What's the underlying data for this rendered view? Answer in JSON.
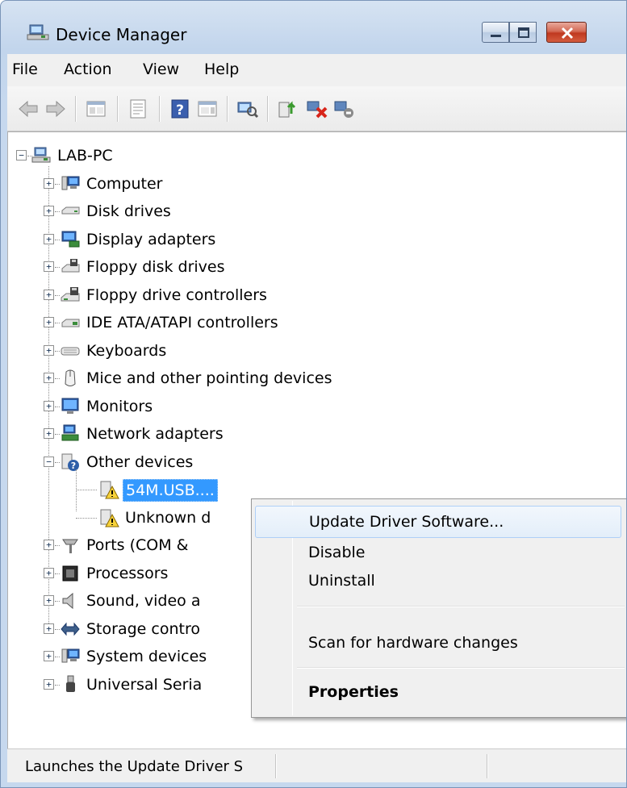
{
  "window": {
    "title": "Device Manager",
    "controls": {
      "minimize": "minimize-icon",
      "maximize": "maximize-icon",
      "close": "close-icon"
    }
  },
  "menubar": {
    "items": [
      "File",
      "Action",
      "View",
      "Help"
    ]
  },
  "toolbar": {
    "icons": [
      "back-arrow-icon",
      "forward-arrow-icon",
      "console-tree-icon",
      "properties-sheet-icon",
      "help-icon",
      "action-pane-icon",
      "scan-hardware-icon",
      "update-driver-icon",
      "uninstall-icon",
      "disable-icon"
    ]
  },
  "tree": {
    "root": "LAB-PC",
    "categories": [
      {
        "label": "Computer",
        "icon": "computer-icon"
      },
      {
        "label": "Disk drives",
        "icon": "disk-drive-icon"
      },
      {
        "label": "Display adapters",
        "icon": "display-adapter-icon"
      },
      {
        "label": "Floppy disk drives",
        "icon": "floppy-disk-icon"
      },
      {
        "label": "Floppy drive controllers",
        "icon": "floppy-controller-icon"
      },
      {
        "label": "IDE ATA/ATAPI controllers",
        "icon": "ide-controller-icon"
      },
      {
        "label": "Keyboards",
        "icon": "keyboard-icon"
      },
      {
        "label": "Mice and other pointing devices",
        "icon": "mouse-icon"
      },
      {
        "label": "Monitors",
        "icon": "monitor-icon"
      },
      {
        "label": "Network adapters",
        "icon": "network-adapter-icon"
      },
      {
        "label": "Other devices",
        "icon": "unknown-device-icon",
        "expanded": true
      },
      {
        "label": "Ports (COM &",
        "icon": "port-icon"
      },
      {
        "label": "Processors",
        "icon": "processor-icon"
      },
      {
        "label": "Sound, video a",
        "icon": "speaker-icon"
      },
      {
        "label": "Storage contro",
        "icon": "storage-icon"
      },
      {
        "label": "System devices",
        "icon": "computer-icon"
      },
      {
        "label": "Universal Seria",
        "icon": "usb-icon"
      }
    ],
    "other_devices": [
      {
        "label": "54M.USB....",
        "icon": "warning-device-icon",
        "selected": true
      },
      {
        "label": "Unknown d",
        "icon": "warning-device-icon"
      }
    ]
  },
  "context_menu": {
    "items": [
      {
        "label": "Update Driver Software...",
        "highlighted": true
      },
      {
        "label": "Disable"
      },
      {
        "label": "Uninstall"
      },
      {
        "label": "Scan for hardware changes"
      },
      {
        "label": "Properties",
        "bold": true
      }
    ]
  },
  "statusbar": {
    "text": "Launches the Update Driver S"
  },
  "colors": {
    "selection": "#3399ff",
    "menu_highlight": "#aecff7",
    "frame": "#c2d5ec"
  }
}
